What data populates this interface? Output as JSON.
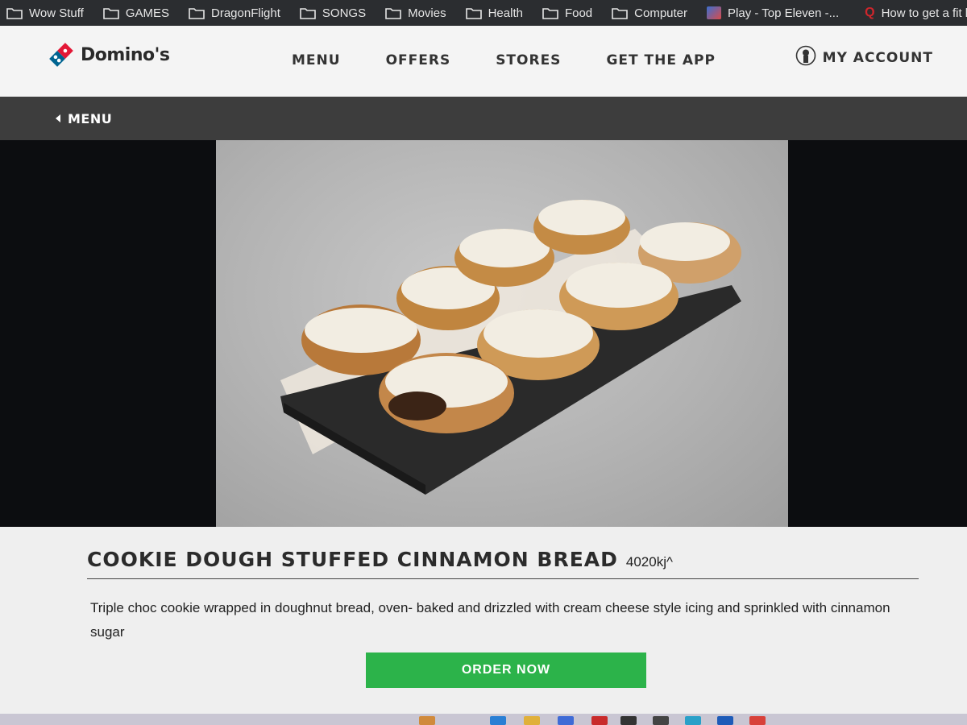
{
  "bookmarks": [
    {
      "label": "Wow Stuff",
      "icon": "folder-icon"
    },
    {
      "label": "GAMES",
      "icon": "folder-icon"
    },
    {
      "label": "DragonFlight",
      "icon": "folder-icon"
    },
    {
      "label": "SONGS",
      "icon": "folder-icon"
    },
    {
      "label": "Movies",
      "icon": "folder-icon"
    },
    {
      "label": "Health",
      "icon": "folder-icon"
    },
    {
      "label": "Food",
      "icon": "folder-icon"
    },
    {
      "label": "Computer",
      "icon": "folder-icon"
    },
    {
      "label": "Play - Top Eleven -...",
      "icon": "game-favicon"
    },
    {
      "label": "How to get a fit bo",
      "icon": "quora-favicon"
    }
  ],
  "brand": {
    "name": "Domino's",
    "colors": {
      "red": "#e31837",
      "blue": "#006491"
    }
  },
  "nav": {
    "links": [
      "MENU",
      "OFFERS",
      "STORES",
      "GET THE APP"
    ],
    "account_label": "MY ACCOUNT"
  },
  "subnav": {
    "back_label": "MENU"
  },
  "product": {
    "title": "COOKIE DOUGH STUFFED CINNAMON BREAD",
    "energy": "4020kj^",
    "description": "Triple choc cookie wrapped in doughnut bread, oven- baked and drizzled with cream cheese style icing and sprinkled with cinnamon sugar",
    "order_label": "ORDER NOW"
  },
  "colors": {
    "order_button": "#2cb34a",
    "subnav_bg": "#3d3d3d",
    "nav_bg": "#f4f4f4"
  }
}
